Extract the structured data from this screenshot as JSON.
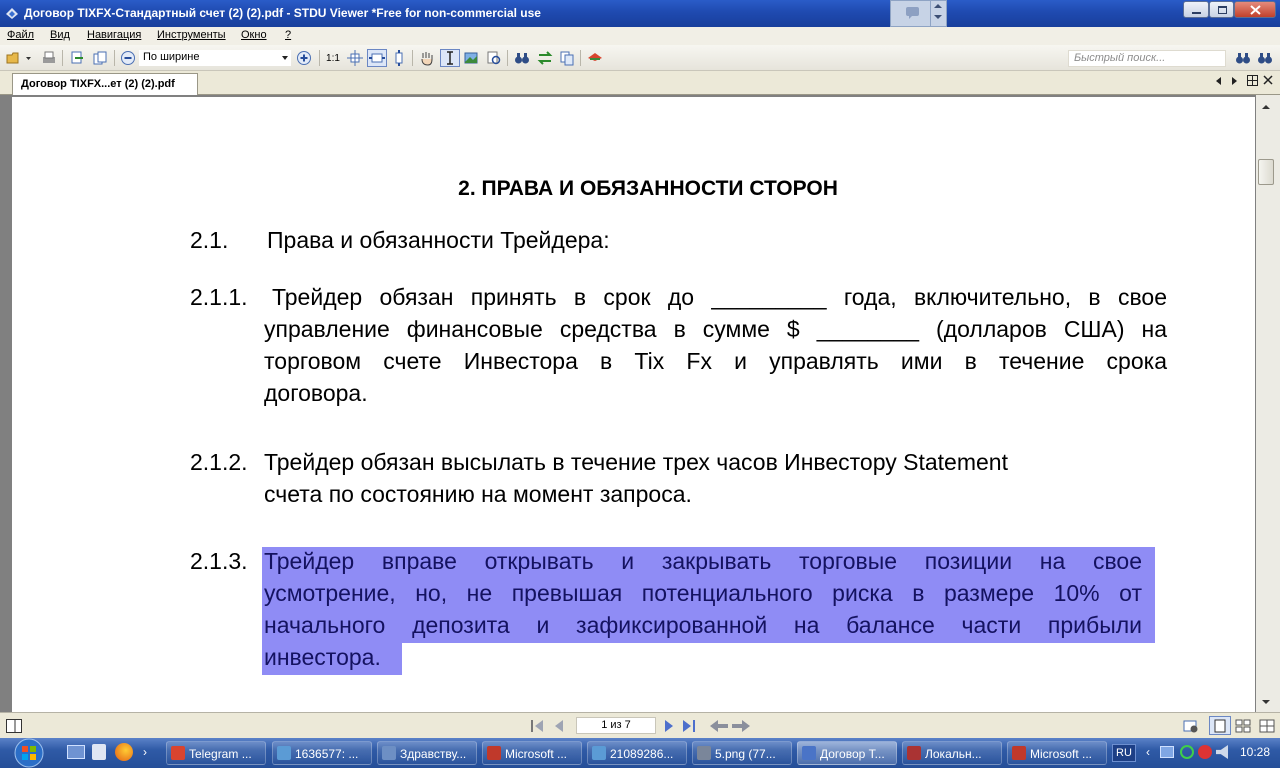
{
  "window": {
    "title": "Договор TIXFX-Стандартный счет (2) (2).pdf - STDU Viewer *Free for non-commercial use"
  },
  "menu": [
    "Файл",
    "Вид",
    "Навигация",
    "Инструменты",
    "Окно",
    "?"
  ],
  "toolbar": {
    "zoom_ratio_label": "1:1",
    "zoom_mode": "По ширине",
    "search_placeholder": "Быстрый поиск..."
  },
  "tab": {
    "label": "Договор TIXFX...ет (2) (2).pdf"
  },
  "document": {
    "heading": "2. ПРАВА И ОБЯЗАННОСТИ СТОРОН",
    "section": {
      "num": "2.1.",
      "text": "Права и обязанности Трейдера:"
    },
    "items": [
      {
        "num": "2.1.1.",
        "lines": [
          "Трейдер обязан принять в срок до _________ года, включительно, в свое",
          "управление финансовые средства в сумме $ ________ (долларов США) на",
          "торговом счете Инвестора в Tix Fx и управлять ими в течение срока",
          "договора."
        ]
      },
      {
        "num": "2.1.2.",
        "lines": [
          "Трейдер обязан высылать в течение трех часов Инвестору Statement",
          "счета по состоянию на момент запроса."
        ]
      },
      {
        "num": "2.1.3.",
        "lines": [
          "Трейдер вправе открывать и закрывать торговые позиции на свое",
          "усмотрение, но, не превышая потенциального риска в размере 10% от",
          "начального депозита и зафиксированной на балансе части прибыли",
          "инвестора."
        ],
        "selected": true
      }
    ]
  },
  "statusbar": {
    "page_indicator": "1 из 7"
  },
  "taskbar": {
    "tasks": [
      {
        "label": "Telegram ...",
        "color": "#d9442f"
      },
      {
        "label": "1636577: ...",
        "color": "#5b9bd5"
      },
      {
        "label": "Здравству...",
        "color": "#6d8fc4"
      },
      {
        "label": "Microsoft ...",
        "color": "#c0392b"
      },
      {
        "label": "21089286...",
        "color": "#5b9bd5"
      },
      {
        "label": "5.png (77...",
        "color": "#7a869a"
      },
      {
        "label": "Договор Т...",
        "color": "#4a74c7"
      },
      {
        "label": "Локальн...",
        "color": "#a33"
      },
      {
        "label": "Microsoft ...",
        "color": "#c0392b"
      }
    ],
    "language": "RU",
    "clock": "10:28"
  },
  "colors": {
    "selection": "#8f8cf5",
    "titlebar": "#2a5cc8",
    "taskbar": "#2f5aa6"
  }
}
